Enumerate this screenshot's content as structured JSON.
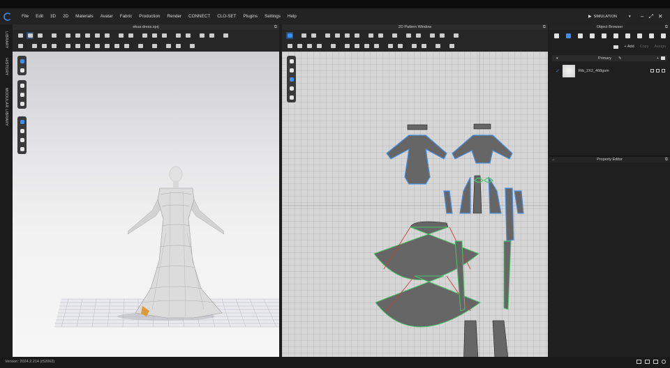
{
  "menu": [
    "File",
    "Edit",
    "3D",
    "2D",
    "Materials",
    "Avatar",
    "Fabric",
    "Production",
    "Render",
    "CONNECT",
    "CLO-SET",
    "Plugins",
    "Settings",
    "Help"
  ],
  "simulation": {
    "label": "SIMULATION",
    "caret": "▾"
  },
  "window_controls": {
    "minimize": "–",
    "maximize": "⤢",
    "close": "✕"
  },
  "left_tabs": [
    "LIBRARY",
    "HISTORY",
    "MODULAR LIBRARY"
  ],
  "panel3d": {
    "title": "ekua dress.zprj"
  },
  "panel2d": {
    "title": "2D Pattern Window"
  },
  "object_browser": {
    "title": "Object Browser",
    "actions": {
      "add": "Add",
      "copy": "Copy",
      "assign": "Assign"
    },
    "section": "Primary",
    "items": [
      {
        "name": "Rib_2X2_468gsm",
        "checked": true
      }
    ]
  },
  "property_editor": {
    "title": "Property Editor"
  },
  "status": {
    "version": "Version: 2024.2.214 (r52062)"
  },
  "colors": {
    "accent": "#3a8ff0",
    "pattern_fill": "#666666",
    "seam_green": "#4cc46a",
    "seam_red": "#c0443a"
  },
  "icons": {
    "pin": "⧉",
    "expand": "⤢"
  }
}
